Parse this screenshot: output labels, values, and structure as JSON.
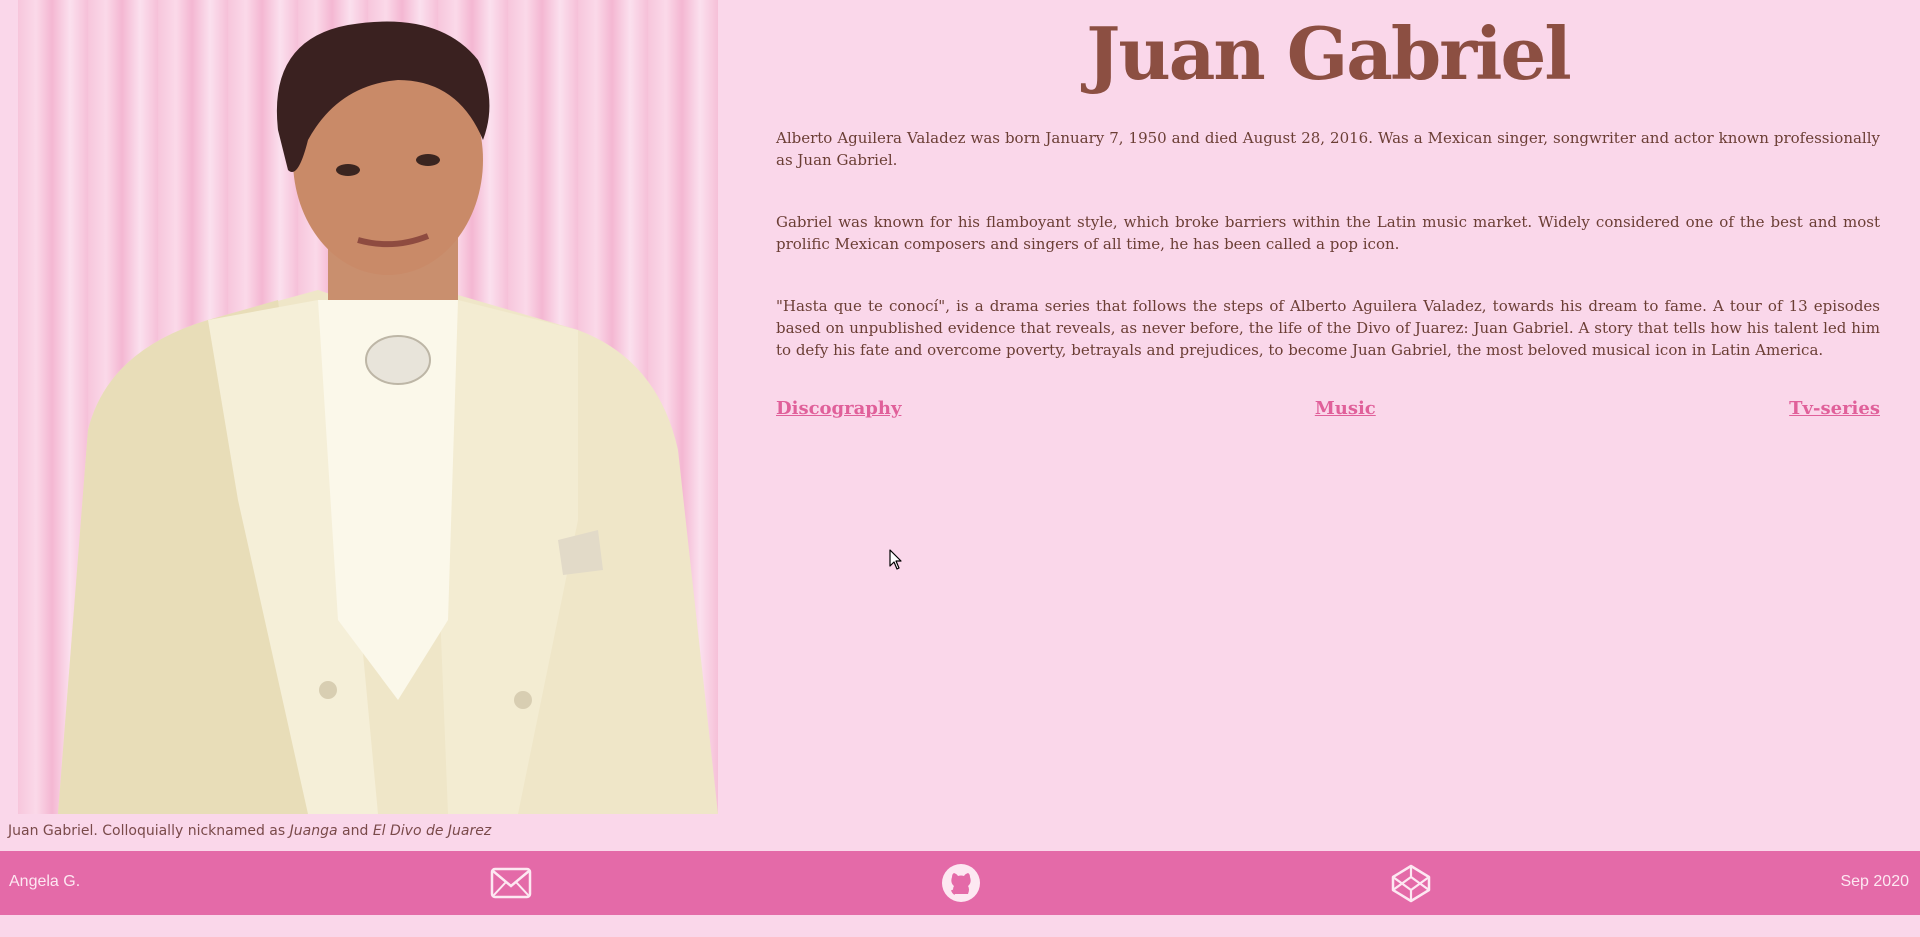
{
  "page": {
    "title": "Juan Gabriel"
  },
  "figure": {
    "caption_prefix": "Juan Gabriel. Colloquially nicknamed as ",
    "nickname1": "Juanga",
    "caption_and": " and ",
    "nickname2": "El Divo de Juarez"
  },
  "paragraphs": [
    "Alberto Aguilera Valadez was born January 7, 1950 and died August 28, 2016. Was a Mexican singer, songwriter and actor known professionally as Juan Gabriel.",
    "Gabriel was known for his flamboyant style, which broke barriers within the Latin music market. Widely considered one of the best and most prolific Mexican composers and singers of all time, he has been called a pop icon.",
    "\"Hasta que te conocí\", is a drama series that follows the steps of Alberto Aguilera Valadez, towards his dream to fame. A tour of 13 episodes based on unpublished evidence that reveals, as never before, the life of the Divo of Juarez: Juan Gabriel. A story that tells how his talent led him to defy his fate and overcome poverty, betrayals and prejudices, to become Juan Gabriel, the most beloved musical icon in Latin America."
  ],
  "links": {
    "discography": "Discography",
    "music": "Music",
    "tvseries": "Tv-series"
  },
  "footer": {
    "author": "Angela G.",
    "date": "Sep 2020",
    "icons": [
      "envelope-icon",
      "github-icon",
      "codepen-icon"
    ]
  },
  "colors": {
    "background": "#fad7ea",
    "title": "#8c4f42",
    "text": "#6b3e35",
    "link": "#e0609a",
    "footer": "#e46aa8"
  }
}
